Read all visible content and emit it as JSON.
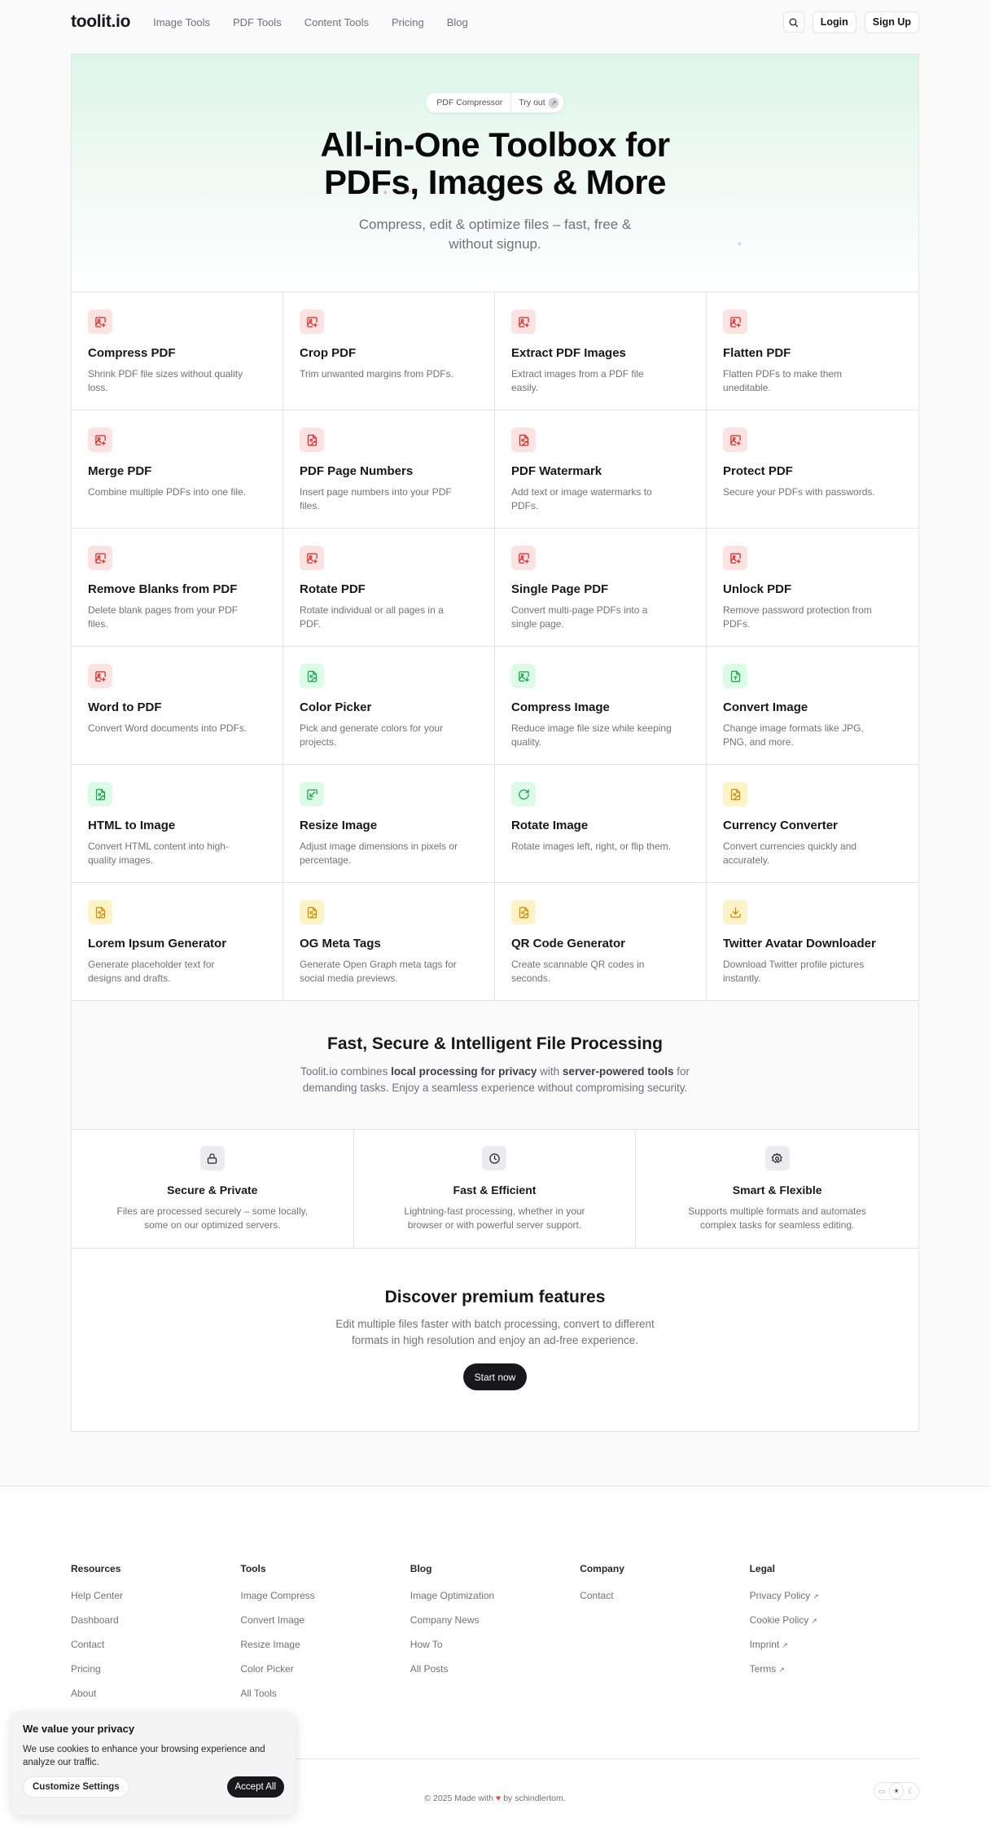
{
  "header": {
    "logo": "toolit.io",
    "nav": [
      "Image Tools",
      "PDF Tools",
      "Content Tools",
      "Pricing",
      "Blog"
    ],
    "search_icon": "search-icon",
    "login_label": "Login",
    "signup_label": "Sign Up"
  },
  "hero": {
    "pill_label": "PDF Compressor",
    "pill_action": "Try out",
    "pill_arrow": "↗",
    "title_line1": "All-in-One Toolbox for",
    "title_line2": "PDFs, Images & More",
    "subtitle": "Compress, edit & optimize files – fast, free & without signup."
  },
  "colors": {
    "red": "#dc2626",
    "green": "#16a34a",
    "yellow": "#ca8a04",
    "dark": "#18181b"
  },
  "tools": [
    {
      "title": "Compress PDF",
      "desc": "Shrink PDF file sizes without quality loss.",
      "color": "red",
      "icon": "image-plus-icon"
    },
    {
      "title": "Crop PDF",
      "desc": "Trim unwanted margins from PDFs.",
      "color": "red",
      "icon": "image-plus-icon"
    },
    {
      "title": "Extract PDF Images",
      "desc": "Extract images from a PDF file easily.",
      "color": "red",
      "icon": "image-plus-icon"
    },
    {
      "title": "Flatten PDF",
      "desc": "Flatten PDFs to make them uneditable.",
      "color": "red",
      "icon": "image-plus-icon"
    },
    {
      "title": "Merge PDF",
      "desc": "Combine multiple PDFs into one file.",
      "color": "red",
      "icon": "image-plus-icon"
    },
    {
      "title": "PDF Page Numbers",
      "desc": "Insert page numbers into your PDF files.",
      "color": "red",
      "icon": "file-image-icon"
    },
    {
      "title": "PDF Watermark",
      "desc": "Add text or image watermarks to PDFs.",
      "color": "red",
      "icon": "file-image-icon"
    },
    {
      "title": "Protect PDF",
      "desc": "Secure your PDFs with passwords.",
      "color": "red",
      "icon": "image-plus-icon"
    },
    {
      "title": "Remove Blanks from PDF",
      "desc": "Delete blank pages from your PDF files.",
      "color": "red",
      "icon": "image-plus-icon"
    },
    {
      "title": "Rotate PDF",
      "desc": "Rotate individual or all pages in a PDF.",
      "color": "red",
      "icon": "image-plus-icon"
    },
    {
      "title": "Single Page PDF",
      "desc": "Convert multi-page PDFs into a single page.",
      "color": "red",
      "icon": "image-plus-icon"
    },
    {
      "title": "Unlock PDF",
      "desc": "Remove password protection from PDFs.",
      "color": "red",
      "icon": "image-plus-icon"
    },
    {
      "title": "Word to PDF",
      "desc": "Convert Word documents into PDFs.",
      "color": "red",
      "icon": "image-plus-icon"
    },
    {
      "title": "Color Picker",
      "desc": "Pick and generate colors for your projects.",
      "color": "green",
      "icon": "file-image-icon"
    },
    {
      "title": "Compress Image",
      "desc": "Reduce image file size while keeping quality.",
      "color": "green",
      "icon": "image-down-icon"
    },
    {
      "title": "Convert Image",
      "desc": "Change image formats like JPG, PNG, and more.",
      "color": "green",
      "icon": "file-type-icon"
    },
    {
      "title": "HTML to Image",
      "desc": "Convert HTML content into high-quality images.",
      "color": "green",
      "icon": "file-image-icon"
    },
    {
      "title": "Resize Image",
      "desc": "Adjust image dimensions in pixels or percentage.",
      "color": "green",
      "icon": "resize-icon"
    },
    {
      "title": "Rotate Image",
      "desc": "Rotate images left, right, or flip them.",
      "color": "green",
      "icon": "rotate-icon"
    },
    {
      "title": "Currency Converter",
      "desc": "Convert currencies quickly and accurately.",
      "color": "yellow",
      "icon": "file-image-icon"
    },
    {
      "title": "Lorem Ipsum Generator",
      "desc": "Generate placeholder text for designs and drafts.",
      "color": "yellow",
      "icon": "file-image-icon"
    },
    {
      "title": "OG Meta Tags",
      "desc": "Generate Open Graph meta tags for social media previews.",
      "color": "yellow",
      "icon": "file-image-icon"
    },
    {
      "title": "QR Code Generator",
      "desc": "Create scannable QR codes in seconds.",
      "color": "yellow",
      "icon": "file-image-icon"
    },
    {
      "title": "Twitter Avatar Downloader",
      "desc": "Download Twitter profile pictures instantly.",
      "color": "yellow",
      "icon": "download-icon"
    }
  ],
  "features_intro": {
    "title": "Fast, Secure & Intelligent File Processing",
    "text_1": "Toolit.io combines ",
    "bold_1": "local processing for privacy",
    "text_2": " with ",
    "bold_2": "server-powered tools",
    "text_3": " for demanding tasks. Enjoy a seamless experience without compromising security."
  },
  "features": [
    {
      "title": "Secure & Private",
      "desc": "Files are processed securely – some locally, some on our optimized servers.",
      "icon": "lock-icon"
    },
    {
      "title": "Fast & Efficient",
      "desc": "Lightning-fast processing, whether in your browser or with powerful server support.",
      "icon": "clock-icon"
    },
    {
      "title": "Smart & Flexible",
      "desc": "Supports multiple formats and automates complex tasks for seamless editing.",
      "icon": "gear-icon"
    }
  ],
  "premium": {
    "title": "Discover premium features",
    "desc": "Edit multiple files faster with batch processing, convert to different formats in high resolution and enjoy an ad-free experience.",
    "cta": "Start now"
  },
  "footer": {
    "columns": [
      {
        "heading": "Resources",
        "links": [
          {
            "label": "Help Center"
          },
          {
            "label": "Dashboard"
          },
          {
            "label": "Contact"
          },
          {
            "label": "Pricing"
          },
          {
            "label": "About"
          }
        ]
      },
      {
        "heading": "Tools",
        "links": [
          {
            "label": "Image Compress"
          },
          {
            "label": "Convert Image"
          },
          {
            "label": "Resize Image"
          },
          {
            "label": "Color Picker"
          },
          {
            "label": "All Tools"
          }
        ]
      },
      {
        "heading": "Blog",
        "links": [
          {
            "label": "Image Optimization"
          },
          {
            "label": "Company News"
          },
          {
            "label": "How To"
          },
          {
            "label": "All Posts"
          }
        ]
      },
      {
        "heading": "Company",
        "links": [
          {
            "label": "Contact"
          }
        ]
      },
      {
        "heading": "Legal",
        "links": [
          {
            "label": "Privacy Policy",
            "external": true
          },
          {
            "label": "Cookie Policy",
            "external": true
          },
          {
            "label": "Imprint",
            "external": true
          },
          {
            "label": "Terms",
            "external": true
          }
        ]
      }
    ],
    "copyright_pre": "© 2025 Made with",
    "heart": "♥",
    "copyright_post": "by schindlertom.",
    "theme_options": [
      {
        "name": "system",
        "icon": "monitor-icon",
        "active": false
      },
      {
        "name": "light",
        "icon": "sun-icon",
        "active": true
      },
      {
        "name": "dark",
        "icon": "moon-icon",
        "active": false
      }
    ]
  },
  "cookie": {
    "title": "We value your privacy",
    "text": "We use cookies to enhance your browsing experience and analyze our traffic.",
    "customize_label": "Customize Settings",
    "accept_label": "Accept All"
  }
}
